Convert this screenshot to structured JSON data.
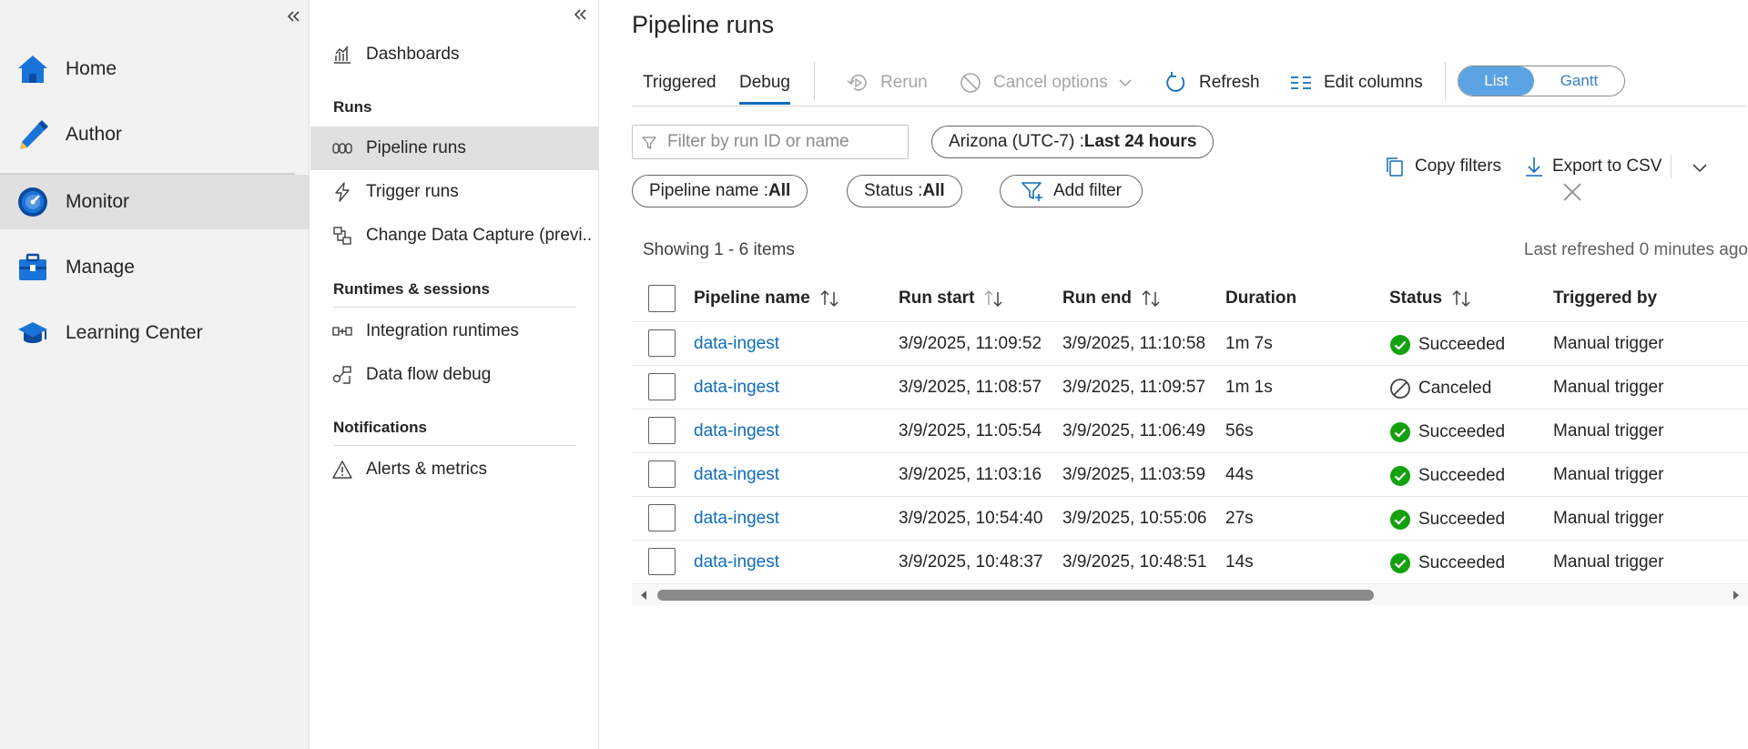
{
  "left_nav": {
    "items": [
      {
        "label": "Home",
        "icon": "home-icon"
      },
      {
        "label": "Author",
        "icon": "pencil-icon"
      },
      {
        "label": "Monitor",
        "icon": "monitor-gauge-icon"
      },
      {
        "label": "Manage",
        "icon": "toolbox-icon"
      },
      {
        "label": "Learning Center",
        "icon": "graduation-cap-icon"
      }
    ],
    "active": "Monitor"
  },
  "sub_nav": {
    "dashboards": "Dashboards",
    "runs_header": "Runs",
    "pipeline_runs": "Pipeline runs",
    "trigger_runs": "Trigger runs",
    "change_data_capture": "Change Data Capture (previ...",
    "runtimes_header": "Runtimes & sessions",
    "integration_runtimes": "Integration runtimes",
    "data_flow_debug": "Data flow debug",
    "notifications_header": "Notifications",
    "alerts_metrics": "Alerts & metrics"
  },
  "main": {
    "title": "Pipeline runs",
    "tabs": [
      {
        "label": "Triggered"
      },
      {
        "label": "Debug"
      }
    ],
    "active_tab": "Debug",
    "toolbar": {
      "rerun": "Rerun",
      "cancel_options": "Cancel options",
      "refresh": "Refresh",
      "edit_columns": "Edit columns",
      "view_list": "List",
      "view_gantt": "Gantt"
    },
    "filters": {
      "search_placeholder": "Filter by run ID or name",
      "timezone_label": "Arizona (UTC-7) : ",
      "timezone_value": "Last 24 hours",
      "pipeline_name_label": "Pipeline name : ",
      "pipeline_name_value": "All",
      "status_label": "Status : ",
      "status_value": "All",
      "add_filter": "Add filter",
      "copy_filters": "Copy filters",
      "export_csv": "Export to CSV"
    },
    "showing": "Showing 1 - 6 items",
    "last_refreshed": "Last refreshed 0 minutes ago",
    "table": {
      "columns": {
        "pipeline_name": "Pipeline name",
        "run_start": "Run start",
        "run_end": "Run end",
        "duration": "Duration",
        "status": "Status",
        "triggered_by": "Triggered by"
      },
      "rows": [
        {
          "name": "data-ingest",
          "start": "3/9/2025, 11:09:52",
          "end": "3/9/2025, 11:10:58",
          "duration": "1m 7s",
          "status": "Succeeded",
          "triggered_by": "Manual trigger"
        },
        {
          "name": "data-ingest",
          "start": "3/9/2025, 11:08:57",
          "end": "3/9/2025, 11:09:57",
          "duration": "1m 1s",
          "status": "Canceled",
          "triggered_by": "Manual trigger"
        },
        {
          "name": "data-ingest",
          "start": "3/9/2025, 11:05:54",
          "end": "3/9/2025, 11:06:49",
          "duration": "56s",
          "status": "Succeeded",
          "triggered_by": "Manual trigger"
        },
        {
          "name": "data-ingest",
          "start": "3/9/2025, 11:03:16",
          "end": "3/9/2025, 11:03:59",
          "duration": "44s",
          "status": "Succeeded",
          "triggered_by": "Manual trigger"
        },
        {
          "name": "data-ingest",
          "start": "3/9/2025, 10:54:40",
          "end": "3/9/2025, 10:55:06",
          "duration": "27s",
          "status": "Succeeded",
          "triggered_by": "Manual trigger"
        },
        {
          "name": "data-ingest",
          "start": "3/9/2025, 10:48:37",
          "end": "3/9/2025, 10:48:51",
          "duration": "14s",
          "status": "Succeeded",
          "triggered_by": "Manual trigger"
        }
      ]
    }
  },
  "colors": {
    "accent": "#0f6cbd",
    "success": "#13a10e",
    "toggle_on": "#5ba3e2"
  }
}
